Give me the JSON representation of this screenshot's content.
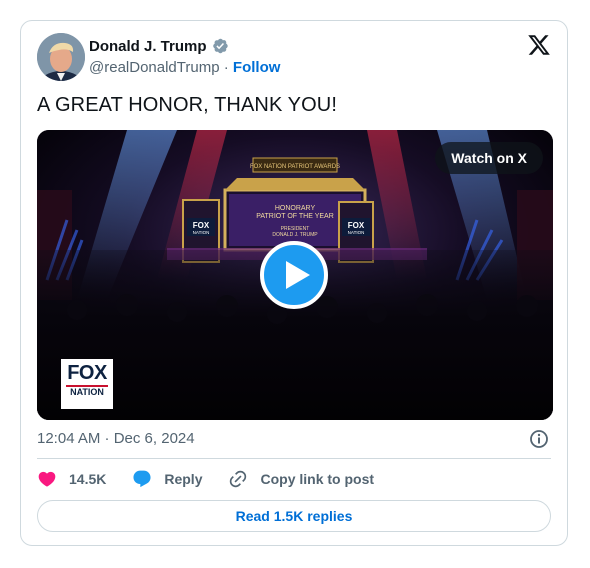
{
  "author": {
    "name": "Donald J. Trump",
    "handle": "@realDonaldTrump",
    "separator": "·",
    "follow_label": "Follow",
    "verified_icon": "verified-badge-icon"
  },
  "tweet": {
    "text": "A GREAT HONOR, THANK YOU!",
    "timestamp": "12:04 AM · Dec 6, 2024"
  },
  "media": {
    "watch_label": "Watch on X",
    "play_icon": "play-icon",
    "stage_banner": "FOX NATION PATRIOT AWARDS",
    "screen_text": [
      "HONORARY",
      "PATRIOT OF THE YEAR",
      "PRESIDENT",
      "DONALD J. TRUMP"
    ],
    "side_logo_text": [
      "FOX",
      "NATION"
    ],
    "corner_logo": {
      "line1": "FOX",
      "line2": "NATION"
    }
  },
  "actions": {
    "likes": "14.5K",
    "reply_label": "Reply",
    "copy_label": "Copy link to post",
    "read_replies_label": "Read 1.5K replies"
  },
  "colors": {
    "accent": "#1d9bf0",
    "link": "#006fd6",
    "like": "#f91880",
    "muted": "#536471",
    "border": "#cfd9de"
  }
}
